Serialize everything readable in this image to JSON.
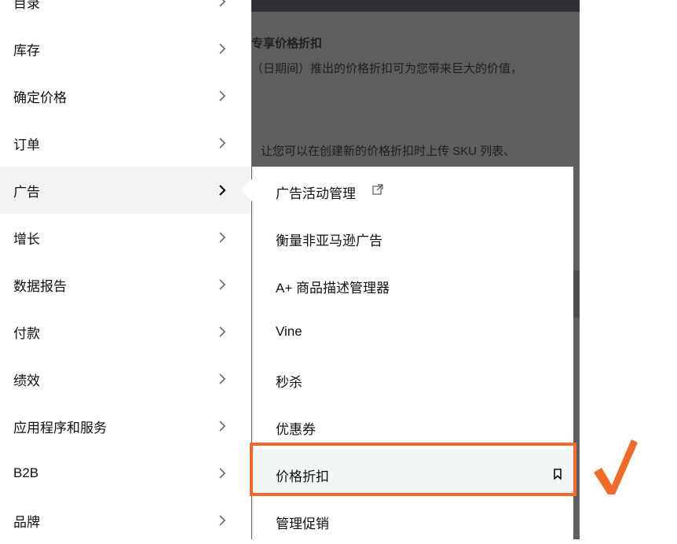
{
  "background_page": {
    "heading": "专享价格折扣",
    "line1": "（日期间）推出的价格折扣可为您带来巨大的价值，",
    "line2": "让您可以在创建新的价格折扣时上传 SKU 列表、"
  },
  "left_menu": {
    "items": [
      {
        "label": "目录"
      },
      {
        "label": "库存"
      },
      {
        "label": "确定价格"
      },
      {
        "label": "订单"
      },
      {
        "label": "广告"
      },
      {
        "label": "增长"
      },
      {
        "label": "数据报告"
      },
      {
        "label": "付款"
      },
      {
        "label": "绩效"
      },
      {
        "label": "应用程序和服务"
      },
      {
        "label": "B2B"
      },
      {
        "label": "品牌"
      }
    ],
    "active_index": 4,
    "chevron_icon": "chevron-right-icon"
  },
  "sub_menu": {
    "items": [
      {
        "label": "广告活动管理",
        "icon": "external-link-icon"
      },
      {
        "label": "衡量非亚马逊广告"
      },
      {
        "label": "A+ 商品描述管理器"
      },
      {
        "label": "Vine"
      },
      {
        "label": "秒杀"
      },
      {
        "label": "优惠券"
      },
      {
        "label": "价格折扣",
        "icon": "bookmark-icon"
      },
      {
        "label": "管理促销"
      }
    ],
    "highlighted_index": 6
  },
  "annotation": {
    "highlight_color": "#f06a2a",
    "check_icon": "check-mark-icon"
  }
}
